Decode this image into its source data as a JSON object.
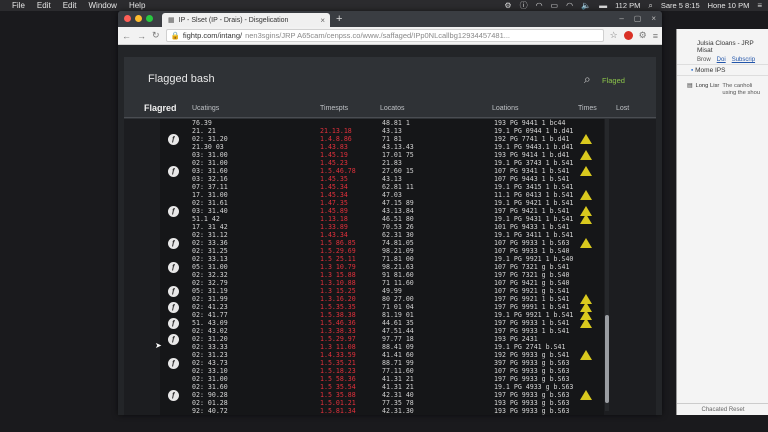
{
  "menubar": {
    "items": [
      "File",
      "Edit",
      "Edit",
      "Window",
      "Help"
    ],
    "time_left": "112 PM",
    "date": "Sare 5 8:15",
    "time_right": "Hone 10 PM"
  },
  "browser": {
    "tab_title": "IP - Slset (IP - Drais) - Disgelication",
    "url_host": "fightp.com/intang/",
    "url_path": "nen3sgins/JRP A65cam/cenpss.co/www./saffaged/IPp0NLcallbg12934457481..."
  },
  "page": {
    "title": "Flagged bash",
    "flag_label": "Flaged",
    "columns": {
      "first": "Flagred",
      "ucatings": "Ucatings",
      "timestamps": "Timespts",
      "locatos": "Locatos",
      "locations": "Loations",
      "times": "Times",
      "lost": "Lost"
    },
    "rows": [
      {
        "time": "76.39",
        "ts": "",
        "loc": "48.81 1",
        "locs": "193 PG 9441 1 bc44",
        "circle": false,
        "warn": false
      },
      {
        "time": "21. 21",
        "ts": "21.13.18",
        "loc": "43.13",
        "locs": "19.1 PG 0944 1 b.d41",
        "circle": false,
        "warn": false
      },
      {
        "time": "02: 31.20",
        "ts": "1.4.8.86",
        "loc": "71 81",
        "locs": "192 PG 7741 1 b.d41",
        "circle": true,
        "warn": true
      },
      {
        "time": "21.30 03",
        "ts": "1.43.83",
        "loc": "43.13.43",
        "locs": "19.1 PG 9443.1 b.d41",
        "circle": false,
        "warn": false
      },
      {
        "time": "03: 31.00",
        "ts": "1.45.19",
        "loc": "17.01 75",
        "locs": "193 PG 9414 1 b.d41",
        "circle": false,
        "warn": true
      },
      {
        "time": "02: 31.00",
        "ts": "1.45.23",
        "loc": "21.83",
        "locs": "19.1 PG 3743 1 b.S41",
        "circle": false,
        "warn": false
      },
      {
        "time": "03: 31.60",
        "ts": "1.5.46.78",
        "loc": "27.60 15",
        "locs": "107 PG 9341 1 b.S41",
        "circle": true,
        "warn": true
      },
      {
        "time": "03: 32.16",
        "ts": "1.45.35",
        "loc": "43.13",
        "locs": "107 PG 9443 1 b.S41",
        "circle": false,
        "warn": false
      },
      {
        "time": "07: 37.11",
        "ts": "1.45.34",
        "loc": "62.81 11",
        "locs": "19.1 PG 3415 1 b.S41",
        "circle": false,
        "warn": false
      },
      {
        "time": "17. 31.00",
        "ts": "1.45.34",
        "loc": "47.03",
        "locs": "11.1 PG 0413 1 b.S41",
        "circle": false,
        "warn": true
      },
      {
        "time": "02: 31.61",
        "ts": "1.47.35",
        "loc": "47.15 89",
        "locs": "19.1 PG 9421 1 b.S41",
        "circle": false,
        "warn": false
      },
      {
        "time": "03: 31.40",
        "ts": "1.45.89",
        "loc": "43.13.84",
        "locs": "197 PG 9421 1 b.S41",
        "circle": true,
        "warn": true
      },
      {
        "time": "51.1 42",
        "ts": "1.13.18",
        "loc": "46.51 80",
        "locs": "19.1 PG 9431 1 b.S41",
        "circle": false,
        "warn": true
      },
      {
        "time": "17. 31 42",
        "ts": "1.33.89",
        "loc": "70.53 26",
        "locs": "101 PG 9433 1 b.S41",
        "circle": false,
        "warn": false
      },
      {
        "time": "02: 31.12",
        "ts": "1.43.34",
        "loc": "62.31 30",
        "locs": "19.1 PG 3411 1 b.S41",
        "circle": false,
        "warn": false
      },
      {
        "time": "02: 33.36",
        "ts": "1.5 86.85",
        "loc": "74.81.05",
        "locs": "107 PG 9933 1 b.S63",
        "circle": true,
        "warn": true
      },
      {
        "time": "02: 31.25",
        "ts": "1.5.29.69",
        "loc": "98.21.09",
        "locs": "107 PG 9933 1 b.S40",
        "circle": false,
        "warn": false
      },
      {
        "time": "02: 33.13",
        "ts": "1.5 25.11",
        "loc": "71.81 00",
        "locs": "19.1 PG 9921 1 b.S40",
        "circle": false,
        "warn": false
      },
      {
        "time": "05: 31.00",
        "ts": "1.3 10.79",
        "loc": "98.21.63",
        "locs": "107 PG 7321 g b.S41",
        "circle": true,
        "warn": false
      },
      {
        "time": "02: 32.32",
        "ts": "1.3 15.88",
        "loc": "91 81.60",
        "locs": "197 PG 7321 g b.S40",
        "circle": false,
        "warn": false
      },
      {
        "time": "02: 32.79",
        "ts": "1.3.10.88",
        "loc": "71 11.60",
        "locs": "107 PG 9421 g b.S40",
        "circle": false,
        "warn": false
      },
      {
        "time": "05: 31.19",
        "ts": "1.3 15.25",
        "loc": "49.99",
        "locs": "107 PG 9921 g b.S41",
        "circle": true,
        "warn": false
      },
      {
        "time": "02: 31.99",
        "ts": "1.3.16.20",
        "loc": "80 27.00",
        "locs": "197 PG 9921 1 b.S41",
        "circle": false,
        "warn": true
      },
      {
        "time": "02: 41.23",
        "ts": "1.5.35.35",
        "loc": "71 01 04",
        "locs": "197 PG 9991 1 b.S41",
        "circle": true,
        "warn": true
      },
      {
        "time": "02: 41.77",
        "ts": "1.5.38.38",
        "loc": "81.19 01",
        "locs": "19.1 PG 9921 1 b.S41",
        "circle": false,
        "warn": true
      },
      {
        "time": "51. 43.09",
        "ts": "1.5.46.36",
        "loc": "44.61 35",
        "locs": "197 PG 9933 1 b.S41",
        "circle": true,
        "warn": true
      },
      {
        "time": "02: 43.02",
        "ts": "1.3.38.33",
        "loc": "47.51.44",
        "locs": "197 PG 9933 1 b.S41",
        "circle": false,
        "warn": false
      },
      {
        "time": "02: 31.20",
        "ts": "1.5.29.97",
        "loc": "97.77 18",
        "locs": "193 PG 2431",
        "circle": true,
        "warn": false
      },
      {
        "time": "02: 33.33",
        "ts": "1.3 11.08",
        "loc": "88.41 09",
        "locs": "19.1 PG 2741 b.S41",
        "circle": false,
        "warn": false
      },
      {
        "time": "02: 31.23",
        "ts": "1.4.33.59",
        "loc": "41.41 60",
        "locs": "192 PG 9933 g b.S41",
        "circle": false,
        "warn": true
      },
      {
        "time": "02: 43.73",
        "ts": "1.5.35.21",
        "loc": "88.71 99",
        "locs": "397 PG 9933 g b.S63",
        "circle": true,
        "warn": false
      },
      {
        "time": "02: 33.10",
        "ts": "1.5.18.23",
        "loc": "77.11.60",
        "locs": "107 PG 9933 g b.S63",
        "circle": false,
        "warn": false
      },
      {
        "time": "02: 31.00",
        "ts": "1.5 58.36",
        "loc": "41.31 21",
        "locs": "197 PG 9933 g b.S63",
        "circle": false,
        "warn": false
      },
      {
        "time": "02: 31.60",
        "ts": "1.5 35.54",
        "loc": "41.31 21",
        "locs": "19.1 PG 4933 g b.S63",
        "circle": false,
        "warn": false
      },
      {
        "time": "02: 90.28",
        "ts": "1.5 35.88",
        "loc": "42.31 40",
        "locs": "197 PG 9933 g b.S63",
        "circle": true,
        "warn": true
      },
      {
        "time": "02: 01.28",
        "ts": "1.5.01.21",
        "loc": "77.35 78",
        "locs": "193 PG 9933 g b.S63",
        "circle": false,
        "warn": false
      },
      {
        "time": "92: 40.72",
        "ts": "1.5.81.34",
        "loc": "42.31.30",
        "locs": "193 PG 9933 g b.S63",
        "circle": false,
        "warn": false
      }
    ]
  },
  "side": {
    "title": "Julsia Cloans - JRP Misat",
    "bar": [
      "Brow",
      "Doi",
      "Subscrip"
    ],
    "home": "Mome IPS",
    "item_label": "Long Lisr",
    "item_desc1": "The canholi",
    "item_desc2": "using the shou",
    "footer": "Chacated  Reset"
  },
  "colors": {
    "accent_green": "#8bc34a",
    "warning": "#d9c91e",
    "timestamp_red": "#e0303b"
  }
}
